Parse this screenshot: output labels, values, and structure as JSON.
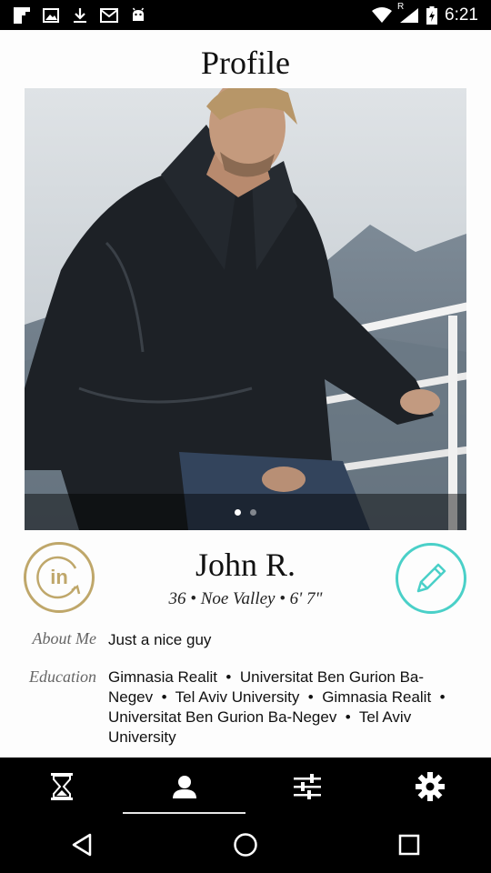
{
  "status_bar": {
    "time": "6:21",
    "icons": [
      "flipboard-icon",
      "gallery-icon",
      "download-icon",
      "mail-icon",
      "android-icon"
    ],
    "roaming_label": "R"
  },
  "header": {
    "title": "Profile"
  },
  "photo": {
    "carousel_pages": 2,
    "active_page": 0
  },
  "profile": {
    "name": "John R.",
    "subline": "36 • Noe Valley • 6' 7\"",
    "about_label": "About Me",
    "about_value": "Just a nice guy",
    "education_label": "Education",
    "education_value": "Gimnasia Realit  •  Universitat Ben Gurion Ba-Negev  •  Tel Aviv University  •  Gimnasia Realit  •  Universitat Ben Gurion Ba-Negev  •  Tel Aviv University",
    "linkedin_label": "in"
  },
  "tabs": [
    {
      "icon": "hourglass-icon",
      "active": false
    },
    {
      "icon": "person-icon",
      "active": true
    },
    {
      "icon": "sliders-icon",
      "active": false
    },
    {
      "icon": "gear-icon",
      "active": false
    }
  ],
  "colors": {
    "linkedin_ring": "#bfa76a",
    "edit_ring": "#4ad0c8",
    "bar_background": "#000000"
  }
}
